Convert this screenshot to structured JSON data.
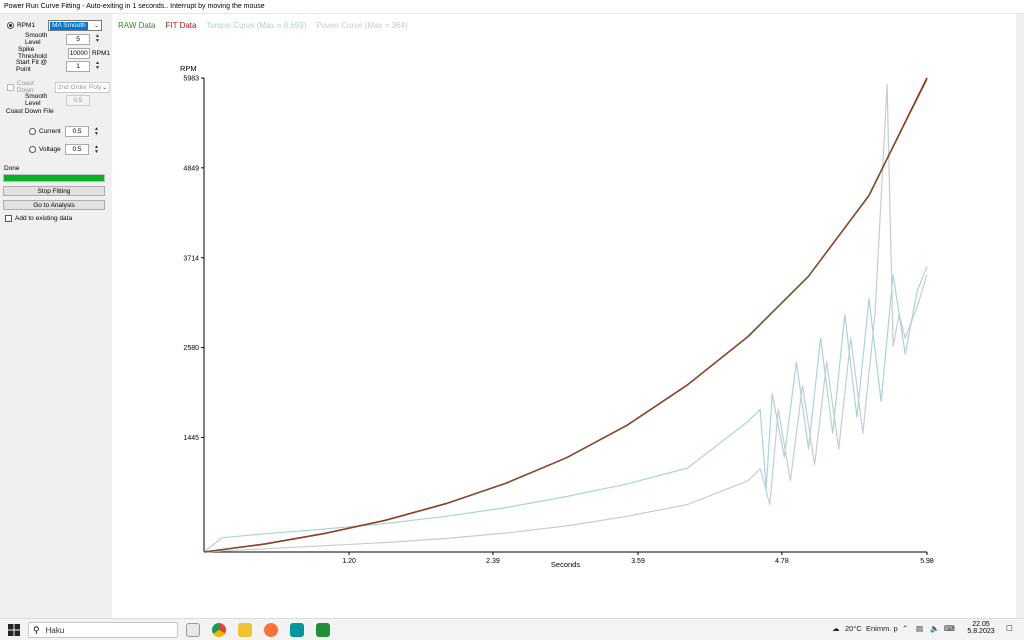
{
  "window": {
    "title": "Power Run Curve Fitting - Auto-exiting in 1 seconds.. Interrupt by moving the mouse"
  },
  "sidebar": {
    "rpm_label": "RPM1",
    "filter_selected": "MA Smooth",
    "smooth_level_label": "Smooth Level",
    "smooth_level_value": "5",
    "spike_threshold_label": "Spike Threshold",
    "spike_threshold_value": "10000",
    "spike_threshold_unit": "RPM1",
    "start_fit_label": "Start Fit @ Point",
    "start_fit_value": "1",
    "coast_down_label": "Coast Down",
    "coast_down_model": "2nd Order Poly",
    "coast_smooth_label": "Smooth Level",
    "coast_smooth_value": "0.5",
    "coast_down_file_label": "Coast Down File",
    "current_label": "Current",
    "current_value": "0.5",
    "voltage_label": "Voltage",
    "voltage_value": "0.5",
    "status_text": "Done",
    "progress": 1.0,
    "stop_fitting_label": "Stop Fitting",
    "go_to_analysis_label": "Go to Analysis",
    "add_existing_label": "Add to existing data"
  },
  "legend": {
    "raw": "RAW Data",
    "fit": "FIT Data",
    "torque": "Torque Curve (Max = 9.693)",
    "power": "Power Curve (Max = 364)"
  },
  "colors": {
    "raw": "#2e8b2e",
    "fit": "#c0141c",
    "torque": "#a8d4dc",
    "power": "#c4cdd3",
    "progress": "#06b025"
  },
  "chart_data": {
    "type": "line",
    "xlabel": "Seconds",
    "ylabel": "RPM",
    "xlim": [
      0,
      5.98
    ],
    "ylim": [
      0,
      5983
    ],
    "x_ticks": [
      "1.20",
      "2.39",
      "3.59",
      "4.78",
      "5.98"
    ],
    "y_ticks": [
      "1445",
      "2580",
      "3714",
      "4849",
      "5983"
    ],
    "series": [
      {
        "name": "FIT Data",
        "x": [
          0,
          0.5,
          1.0,
          1.5,
          2.0,
          2.5,
          3.0,
          3.5,
          4.0,
          4.5,
          5.0,
          5.5,
          5.98
        ],
        "values": [
          0,
          100,
          235,
          400,
          610,
          870,
          1190,
          1600,
          2110,
          2720,
          3480,
          4500,
          5983
        ]
      },
      {
        "name": "RAW Data",
        "x": [
          0,
          0.5,
          1.0,
          1.5,
          2.0,
          2.5,
          3.0,
          3.5,
          4.0,
          4.5,
          5.0,
          5.5,
          5.98
        ],
        "values": [
          0,
          95,
          230,
          395,
          605,
          868,
          1188,
          1598,
          2108,
          2718,
          3478,
          4498,
          5960
        ]
      },
      {
        "name": "Torque Curve (Max = 9.693)",
        "x": [
          0,
          0.15,
          0.5,
          1.0,
          1.5,
          2.0,
          2.5,
          3.0,
          3.5,
          4.0,
          4.5,
          4.6,
          4.65,
          4.7,
          4.8,
          4.9,
          5.0,
          5.1,
          5.2,
          5.3,
          5.4,
          5.5,
          5.6,
          5.7,
          5.8,
          5.9,
          5.98
        ],
        "values": [
          0,
          180,
          230,
          290,
          360,
          450,
          560,
          700,
          860,
          1060,
          1650,
          1800,
          800,
          2000,
          1200,
          2400,
          1300,
          2700,
          1500,
          3000,
          1700,
          3200,
          1900,
          3500,
          2500,
          3300,
          3600
        ]
      },
      {
        "name": "Power Curve (Max = 364)",
        "x": [
          0,
          0.5,
          1.0,
          1.5,
          2.0,
          2.5,
          3.0,
          3.5,
          4.0,
          4.5,
          4.6,
          4.68,
          4.75,
          4.85,
          4.95,
          5.05,
          5.15,
          5.25,
          5.35,
          5.45,
          5.55,
          5.65,
          5.7,
          5.75,
          5.8,
          5.9,
          5.98
        ],
        "values": [
          0,
          40,
          80,
          120,
          170,
          240,
          330,
          450,
          600,
          900,
          1050,
          600,
          1800,
          900,
          2100,
          1100,
          2400,
          1300,
          2700,
          1500,
          3000,
          5900,
          2600,
          3000,
          2700,
          3100,
          3500
        ]
      }
    ]
  },
  "taskbar": {
    "search_placeholder": "Haku",
    "weather": "20°C",
    "weather_desc": "Enimm. p",
    "time": "22.05",
    "date": "5.8.2023"
  }
}
